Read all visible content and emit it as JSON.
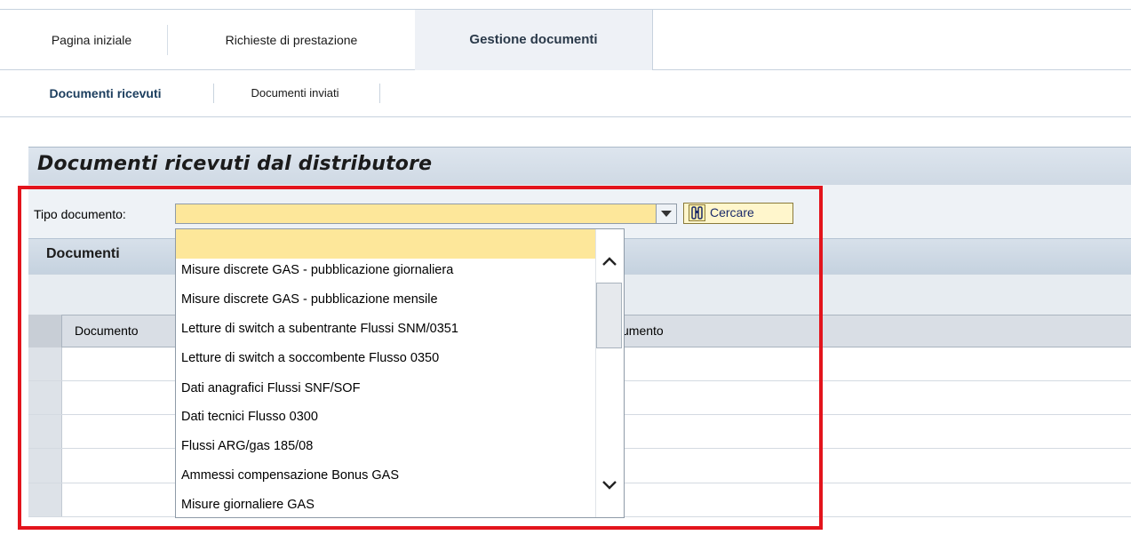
{
  "tabs": [
    {
      "label": "Pagina iniziale",
      "active": false
    },
    {
      "label": "Richieste di prestazione",
      "active": false
    },
    {
      "label": "Gestione documenti",
      "active": true
    }
  ],
  "subtabs": [
    {
      "label": "Documenti ricevuti",
      "active": true
    },
    {
      "label": "Documenti inviati",
      "active": false
    }
  ],
  "panel": {
    "title": "Documenti ricevuti dal distributore",
    "tipo_label": "Tipo documento:",
    "tipo_value": "",
    "search_label": "Cercare"
  },
  "documents": {
    "title": "Documenti",
    "columns": [
      "Documento",
      "umento"
    ]
  },
  "dropdown": {
    "options": [
      "",
      "Misure discrete GAS - pubblicazione giornaliera",
      "Misure discrete GAS - pubblicazione mensile",
      "Letture di switch a subentrante Flussi SNM/0351",
      "Letture di switch a soccombente Flusso 0350",
      "Dati anagrafici Flussi SNF/SOF",
      "Dati tecnici Flusso 0300",
      "Flussi ARG/gas 185/08",
      "Ammessi compensazione Bonus GAS",
      "Misure giornaliere GAS"
    ]
  },
  "colors": {
    "highlight": "#e3141c",
    "selected_option": "#fde79a"
  }
}
